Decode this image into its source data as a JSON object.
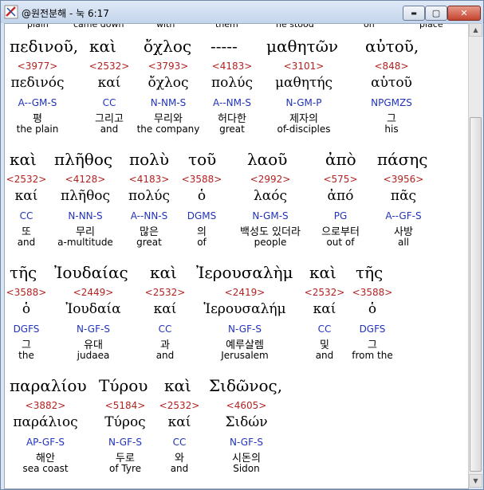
{
  "window": {
    "title": "@원전분해 - 눅 6:17"
  },
  "controls": {
    "min": "▬",
    "max": "▢",
    "close": "✕"
  },
  "cut_top": [
    "plain",
    "came down",
    "with",
    "them",
    "he stood",
    "on",
    "place"
  ],
  "rows": [
    [
      {
        "greek": "πεδινοῦ,",
        "num": "<3977>",
        "lex": "πεδινός",
        "parse": "A--GM-S",
        "ko": "평",
        "en": "the plain"
      },
      {
        "greek": "καὶ",
        "num": "<2532>",
        "lex": "καί",
        "parse": "CC",
        "ko": "그리고",
        "en": "and"
      },
      {
        "greek": "ὄχλος",
        "num": "<3793>",
        "lex": "ὄχλος",
        "parse": "N-NM-S",
        "ko": "무리와",
        "en": "the company"
      },
      {
        "greek": "-----",
        "num": "<4183>",
        "lex": "πολύς",
        "parse": "A--NM-S",
        "ko": "허다한",
        "en": "great"
      },
      {
        "greek": "μαθητῶν",
        "num": "<3101>",
        "lex": "μαθητής",
        "parse": "N-GM-P",
        "ko": "제자의",
        "en": "of-disciples"
      },
      {
        "greek": "αὐτοῦ,",
        "num": "<848>",
        "lex": "αὑτοῦ",
        "parse": "NPGMZS",
        "ko": "그",
        "en": "his"
      }
    ],
    [
      {
        "greek": "καὶ",
        "num": "<2532>",
        "lex": "καί",
        "parse": "CC",
        "ko": "또",
        "en": "and"
      },
      {
        "greek": "πλῆθος",
        "num": "<4128>",
        "lex": "πλῆθος",
        "parse": "N-NN-S",
        "ko": "무리",
        "en": "a-multitude"
      },
      {
        "greek": "πολὺ",
        "num": "<4183>",
        "lex": "πολύς",
        "parse": "A--NN-S",
        "ko": "많은",
        "en": "great"
      },
      {
        "greek": "τοῦ",
        "num": "<3588>",
        "lex": "ὁ",
        "parse": "DGMS",
        "ko": "의",
        "en": "of"
      },
      {
        "greek": "λαοῦ",
        "num": "<2992>",
        "lex": "λαός",
        "parse": "N-GM-S",
        "ko": "백성도 있더라",
        "en": "people"
      },
      {
        "greek": "ἀπὸ",
        "num": "<575>",
        "lex": "ἀπό",
        "parse": "PG",
        "ko": "으로부터",
        "en": "out of"
      },
      {
        "greek": "πάσης",
        "num": "<3956>",
        "lex": "πᾶς",
        "parse": "A--GF-S",
        "ko": "사방",
        "en": "all"
      }
    ],
    [
      {
        "greek": "τῆς",
        "num": "<3588>",
        "lex": "ὁ",
        "parse": "DGFS",
        "ko": "그",
        "en": "the"
      },
      {
        "greek": "Ἰουδαίας",
        "num": "<2449>",
        "lex": "Ἰουδαία",
        "parse": "N-GF-S",
        "ko": "유대",
        "en": "judaea"
      },
      {
        "greek": "καὶ",
        "num": "<2532>",
        "lex": "καί",
        "parse": "CC",
        "ko": "과",
        "en": "and"
      },
      {
        "greek": "Ἰερουσαλὴμ",
        "num": "<2419>",
        "lex": "Ἱερουσαλήμ",
        "parse": "N-GF-S",
        "ko": "예루살렘",
        "en": "Jerusalem"
      },
      {
        "greek": "καὶ",
        "num": "<2532>",
        "lex": "καί",
        "parse": "CC",
        "ko": "및",
        "en": "and"
      },
      {
        "greek": "τῆς",
        "num": "<3588>",
        "lex": "ὁ",
        "parse": "DGFS",
        "ko": "그",
        "en": "from the"
      }
    ],
    [
      {
        "greek": "παραλίου",
        "num": "<3882>",
        "lex": "παράλιος",
        "parse": "AP-GF-S",
        "ko": "해안",
        "en": "sea coast"
      },
      {
        "greek": "Τύρου",
        "num": "<5184>",
        "lex": "Τύρος",
        "parse": "N-GF-S",
        "ko": "두로",
        "en": "of Tyre"
      },
      {
        "greek": "καὶ",
        "num": "<2532>",
        "lex": "καί",
        "parse": "CC",
        "ko": "와",
        "en": "and"
      },
      {
        "greek": "Σιδῶνος,",
        "num": "<4605>",
        "lex": "Σιδών",
        "parse": "N-GF-S",
        "ko": "시돈의",
        "en": "Sidon"
      }
    ]
  ]
}
